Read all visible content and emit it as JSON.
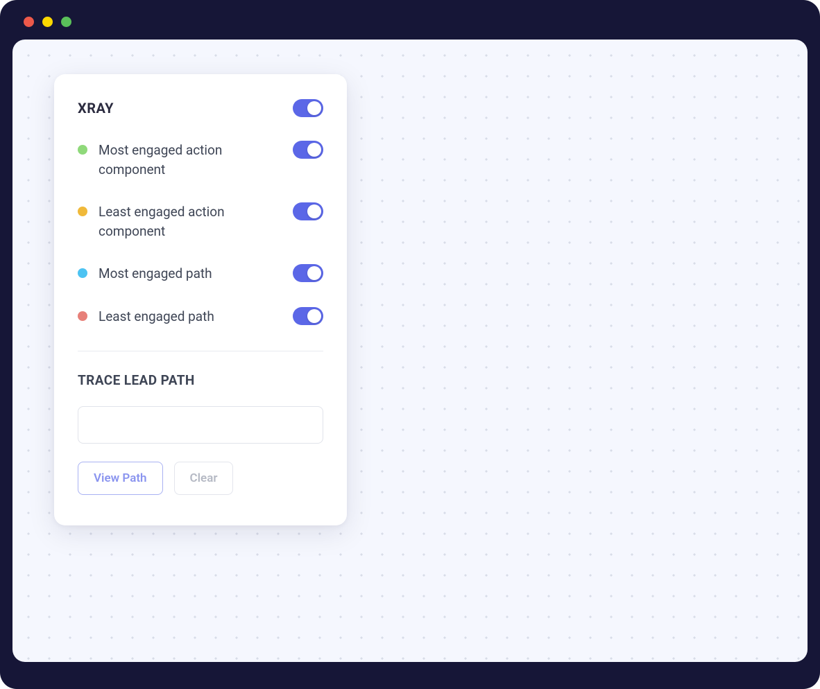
{
  "colors": {
    "accent": "#5B67E7",
    "dot_green": "#8FD97A",
    "dot_yellow": "#F0B93A",
    "dot_blue": "#4DC3F2",
    "dot_red": "#E78079"
  },
  "panel": {
    "title": "XRAY",
    "main_toggle_on": true,
    "items": [
      {
        "label": "Most engaged action component",
        "color_key": "dot_green",
        "on": true
      },
      {
        "label": "Least engaged action component",
        "color_key": "dot_yellow",
        "on": true
      },
      {
        "label": "Most engaged path",
        "color_key": "dot_blue",
        "on": true
      },
      {
        "label": "Least engaged path",
        "color_key": "dot_red",
        "on": true
      }
    ],
    "trace": {
      "title": "TRACE LEAD PATH",
      "input_value": "",
      "input_placeholder": "",
      "view_path_label": "View Path",
      "clear_label": "Clear"
    }
  }
}
